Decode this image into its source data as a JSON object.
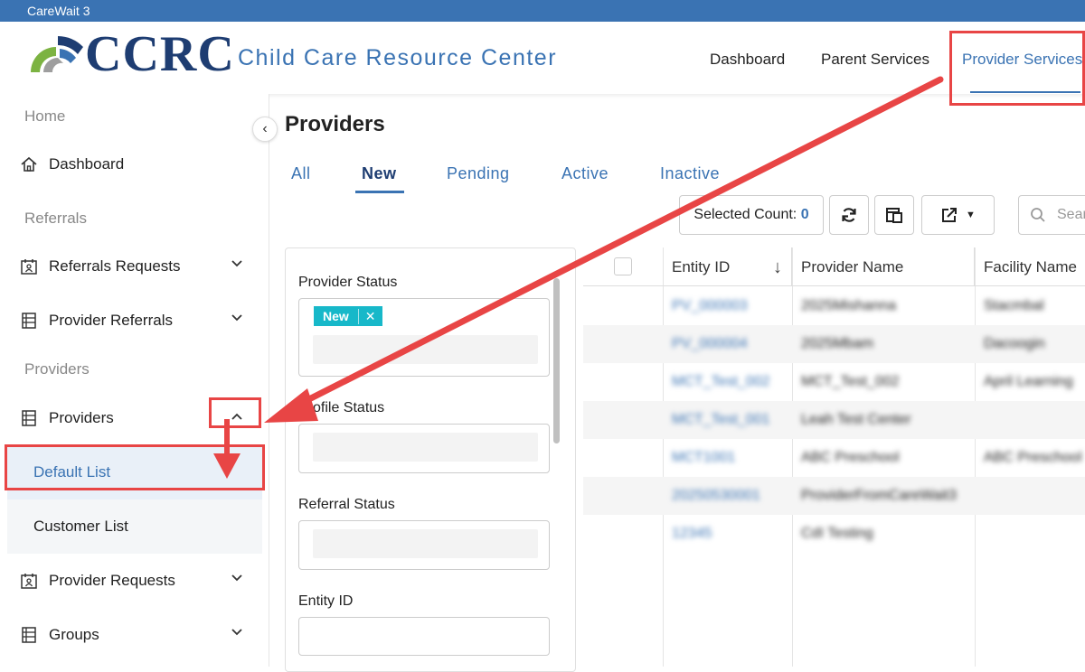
{
  "window": {
    "title": "CareWait 3"
  },
  "brand": {
    "logo_text": "CCRC",
    "subtitle": "Child Care Resource Center"
  },
  "topnav": {
    "dashboard": "Dashboard",
    "parent_services": "Parent Services",
    "provider_services": "Provider Services"
  },
  "sidebar": {
    "home": "Home",
    "dashboard": "Dashboard",
    "referrals_section": "Referrals",
    "referrals_requests": "Referrals Requests",
    "provider_referrals": "Provider Referrals",
    "providers_section": "Providers",
    "providers": "Providers",
    "default_list": "Default List",
    "customer_list": "Customer List",
    "provider_requests": "Provider Requests",
    "groups": "Groups"
  },
  "page": {
    "title": "Providers"
  },
  "tabs": [
    "All",
    "New",
    "Pending",
    "Active",
    "Inactive"
  ],
  "toolbar": {
    "selected_count_label": "Selected Count:",
    "selected_count_value": "0",
    "search_placeholder": "Sear"
  },
  "filters": {
    "provider_status": "Provider Status",
    "provider_status_chip": "New",
    "profile_status": "Profile Status",
    "referral_status": "Referral Status",
    "entity_id": "Entity ID"
  },
  "table": {
    "columns": [
      "Entity ID",
      "Provider Name",
      "Facility Name"
    ],
    "rows": [
      [
        "PV_000003",
        "2025Mishanna",
        "Stacmbal"
      ],
      [
        "PV_000004",
        "2025Mbam",
        "Dacoogin"
      ],
      [
        "MCT_Test_002",
        "MCT_Test_002",
        "April Learning"
      ],
      [
        "MCT_Test_001",
        "Leah Test Center",
        ""
      ],
      [
        "MCT1001",
        "ABC Preschool",
        "ABC Preschool"
      ],
      [
        "20250530001",
        "ProviderFromCareWait3",
        ""
      ],
      [
        "12345",
        "CdI Testing",
        ""
      ]
    ]
  },
  "colors": {
    "accent": "#3a73b3",
    "callout": "#e84545",
    "chip": "#17b8c9"
  }
}
